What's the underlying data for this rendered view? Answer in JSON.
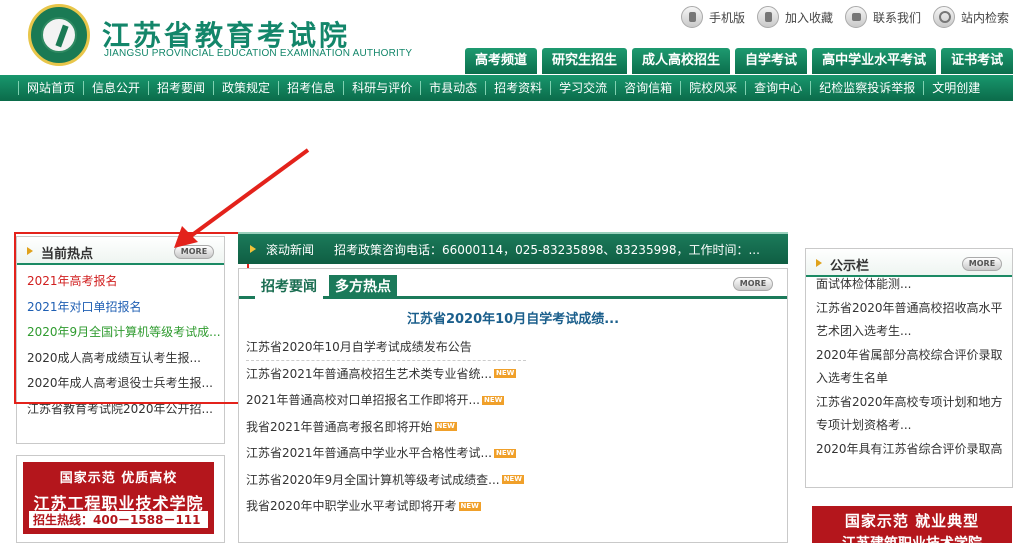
{
  "header": {
    "title": "江苏省教育考试院",
    "subtitle": "JIANGSU PROVINCIAL EDUCATION EXAMINATION AUTHORITY",
    "utilities": [
      {
        "label": "手机版",
        "icon": "mobile-icon"
      },
      {
        "label": "加入收藏",
        "icon": "favorite-icon"
      },
      {
        "label": "联系我们",
        "icon": "home-icon"
      },
      {
        "label": "站内检索",
        "icon": "search-icon"
      }
    ],
    "tabs": [
      "高考频道",
      "研究生招生",
      "成人高校招生",
      "自学考试",
      "高中学业水平考试",
      "证书考试"
    ]
  },
  "nav": [
    "网站首页",
    "信息公开",
    "招考要闻",
    "政策规定",
    "招考信息",
    "科研与评价",
    "市县动态",
    "招考资料",
    "学习交流",
    "咨询信箱",
    "院校风采",
    "查询中心",
    "纪检监察投诉举报",
    "文明创建"
  ],
  "hot": {
    "title": "当前热点",
    "more": "MORE",
    "items": [
      {
        "text": "2021年高考报名",
        "color": "#d11f1f"
      },
      {
        "text": "2021年对口单招报名",
        "color": "#1f5fb3"
      },
      {
        "text": "2020年9月全国计算机等级考试成...",
        "color": "#2f9b2f"
      },
      {
        "text": "2020成人高考成绩互认考生报...",
        "color": "#333333"
      },
      {
        "text": "2020年成人高考退役士兵考生报...",
        "color": "#333333"
      },
      {
        "text": "江苏省教育考试院2020年公开招...",
        "color": "#333333"
      }
    ]
  },
  "ad_left": {
    "line1": "国家示范 优质高校",
    "line2": "江苏工程职业技术学院",
    "line3": "招生热线：400－1588－111"
  },
  "ticker": {
    "label": "滚动新闻",
    "text": "招考政策咨询电话：66000114，025-83235898、83235998，工作时间：..."
  },
  "center": {
    "tabs": [
      "招考要闻",
      "多方热点"
    ],
    "more": "MORE",
    "headline": "江苏省2020年10月自学考试成绩...",
    "new_tag": "NEW",
    "news": [
      {
        "text": "江苏省2020年10月自学考试成绩发布公告",
        "new": false
      },
      {
        "text": "江苏省2021年普通高校招生艺术类专业省统...",
        "new": true
      },
      {
        "text": "2021年普通高校对口单招报名工作即将开...",
        "new": true
      },
      {
        "text": "我省2021年普通高考报名即将开始",
        "new": true
      },
      {
        "text": "江苏省2021年普通高中学业水平合格性考试...",
        "new": true
      },
      {
        "text": "江苏省2020年9月全国计算机等级考试成绩查...",
        "new": true
      },
      {
        "text": "我省2020年中职学业水平考试即将开考",
        "new": true
      }
    ]
  },
  "notice": {
    "title": "公示栏",
    "more": "MORE",
    "lines": [
      "面试体检体能测...",
      "江苏省2020年普通高校招收高水平",
      "艺术团入选考生...",
      "2020年省属部分高校综合评价录取",
      "入选考生名单",
      "江苏省2020年高校专项计划和地方",
      "专项计划资格考...",
      "2020年具有江苏省综合评价录取高"
    ]
  },
  "ad_right": {
    "line1": "国家示范  就业典型",
    "line2": "江苏建筑职业技术学院"
  },
  "colors": {
    "brand_green": "#13866a",
    "annotation_red": "#e3221b"
  }
}
